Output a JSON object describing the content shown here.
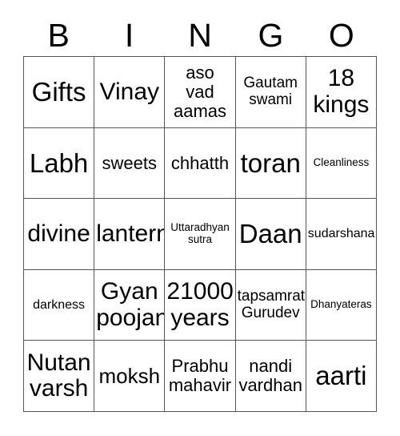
{
  "card": {
    "title": "BINGO card",
    "header_letters": [
      "B",
      "I",
      "N",
      "G",
      "O"
    ],
    "grid": {
      "columns": 5,
      "rows": 5,
      "border_color": "#555555",
      "background_color": "#ffffff",
      "text_color": "#000000"
    },
    "cells": [
      {
        "text": "Gifts",
        "size": "xxl"
      },
      {
        "text": "Vinay",
        "size": "xl"
      },
      {
        "text": "aso\nvad\naamas",
        "size": "md"
      },
      {
        "text": "Gautam\nswami",
        "size": "sm"
      },
      {
        "text": "18\nkings",
        "size": "xl"
      },
      {
        "text": "Labh",
        "size": "xxl"
      },
      {
        "text": "sweets",
        "size": "md"
      },
      {
        "text": "chhatth",
        "size": "md"
      },
      {
        "text": "toran",
        "size": "xxl"
      },
      {
        "text": "Cleanliness",
        "size": "xxs"
      },
      {
        "text": "divine",
        "size": "xl"
      },
      {
        "text": "lantern",
        "size": "xl"
      },
      {
        "text": "Uttaradhyan\nsutra",
        "size": "xxs"
      },
      {
        "text": "Daan",
        "size": "xxl"
      },
      {
        "text": "sudarshana",
        "size": "xs"
      },
      {
        "text": "darkness",
        "size": "xs"
      },
      {
        "text": "Gyan\npoojan",
        "size": "xl"
      },
      {
        "text": "21000\nyears",
        "size": "xl"
      },
      {
        "text": "tapsamrat\nGurudev",
        "size": "sm"
      },
      {
        "text": "Dhanyateras",
        "size": "xxs"
      },
      {
        "text": "Nutan\nvarsh",
        "size": "xl"
      },
      {
        "text": "moksh",
        "size": "lg"
      },
      {
        "text": "Prabhu\nmahavir",
        "size": "md"
      },
      {
        "text": "nandi\nvardhan",
        "size": "md"
      },
      {
        "text": "aarti",
        "size": "xxl"
      }
    ]
  }
}
